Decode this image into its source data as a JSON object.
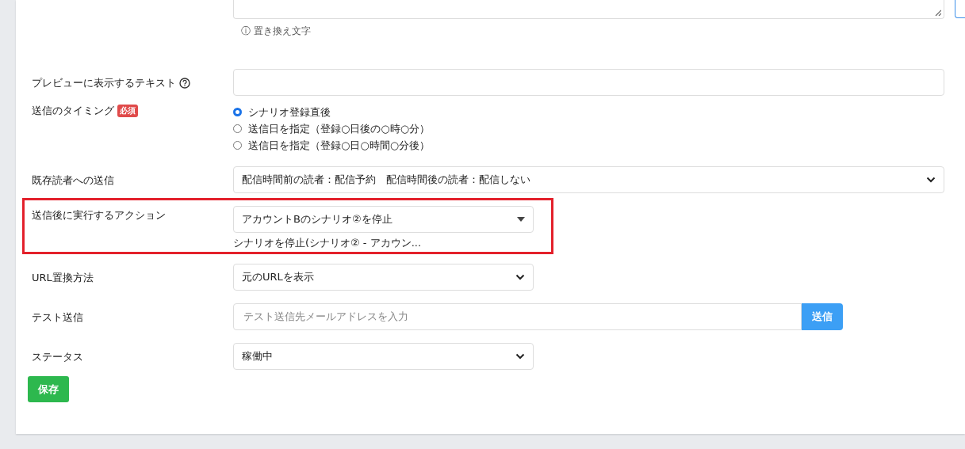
{
  "textarea_hint": "ⓘ 置き換え文字",
  "fields": [
    {
      "kind": "text",
      "label": "プレビューに表示するテキスト",
      "help": true
    },
    {
      "kind": "radio",
      "label": "送信のタイミング",
      "badge": "必須",
      "options": [
        {
          "label": "シナリオ登録直後",
          "selected": true
        },
        {
          "label": "送信日を指定（登録○日後の○時○分）",
          "selected": false
        },
        {
          "label": "送信日を指定（登録○日○時間○分後）",
          "selected": false
        }
      ]
    },
    {
      "kind": "select",
      "label": "既存読者への送信",
      "value": "配信時間前の読者：配信予約　配信時間後の読者：配信しない",
      "wide": true
    },
    {
      "kind": "combo",
      "label": "送信後に実行するアクション",
      "value": "アカウントBのシナリオ②を停止",
      "note": "シナリオを停止(シナリオ② - アカウン...",
      "highlighted": true
    },
    {
      "kind": "select",
      "label": "URL置換方法",
      "value": "元のURLを表示",
      "wide": false
    },
    {
      "kind": "email",
      "label": "テスト送信",
      "placeholder": "テスト送信先メールアドレスを入力",
      "button": "送信"
    },
    {
      "kind": "select",
      "label": "ステータス",
      "value": "稼働中",
      "wide": false
    }
  ],
  "save_button": "保存"
}
